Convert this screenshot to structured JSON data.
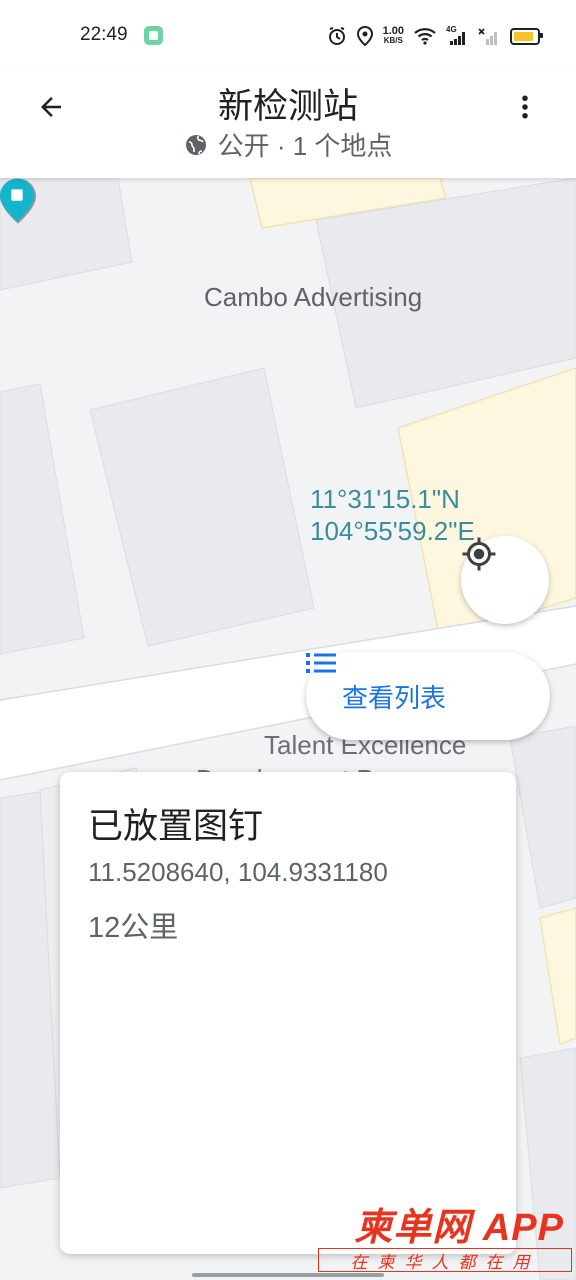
{
  "status_bar": {
    "time": "22:49",
    "net_speed": "1.00",
    "net_unit": "KB/S",
    "network": "4G",
    "icons": [
      "app-indicator-icon",
      "alarm-icon",
      "location-icon",
      "wifi-icon",
      "signal-icon",
      "signal-off-icon",
      "battery-icon"
    ]
  },
  "header": {
    "title": "新检测站",
    "subtitle": "公开 · 1 个地点",
    "back_icon": "arrow-back-icon",
    "more_icon": "more-vert-icon",
    "globe_icon": "globe-icon"
  },
  "map": {
    "poi_label": "Cambo Advertising",
    "pin_coords_lat": "11°31'15.1\"N",
    "pin_coords_lng": "104°55'59.2\"E",
    "talent_label": "Talent Excellence",
    "talent_label_2": "Development Pr"
  },
  "controls": {
    "locate_icon": "my-location-icon",
    "list_button_label": "查看列表",
    "list_icon": "list-icon"
  },
  "card": {
    "title": "已放置图钉",
    "coordinates": "11.5208640, 104.9331180",
    "distance": "12公里"
  },
  "watermark": {
    "brand": "柬单网",
    "suffix": "APP",
    "slogan": "在柬华人都在用"
  },
  "colors": {
    "accent": "#1a73e8",
    "pin": "#12b5cb",
    "coord_text": "#3c8d9c",
    "watermark": "#e8331f"
  }
}
